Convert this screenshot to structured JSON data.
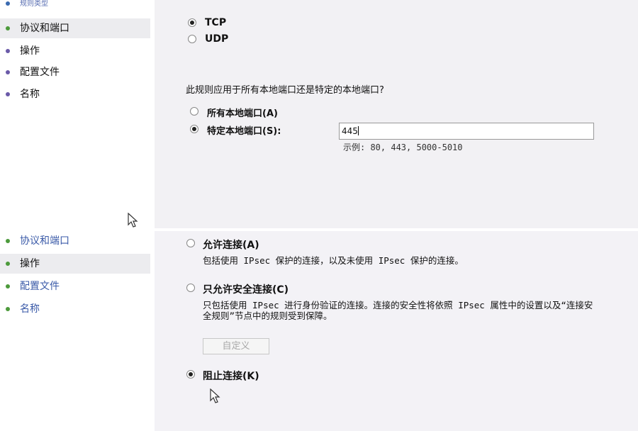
{
  "colors": {
    "content_bg": "#f2f1f4",
    "sidebar_bg": "#ffffff",
    "nav_selected_bg": "#ececef",
    "nav_dot_green": "#4c9a3b",
    "nav_dot_purple": "#6a5aa8"
  },
  "top_sidebar": {
    "cut_item": "规则类型",
    "items": [
      {
        "label": "协议和端口",
        "selected": true
      },
      {
        "label": "操作"
      },
      {
        "label": "配置文件"
      },
      {
        "label": "名称"
      }
    ]
  },
  "protocol": {
    "options": [
      {
        "label": "TCP",
        "checked": true
      },
      {
        "label": "UDP",
        "checked": false
      }
    ]
  },
  "ports": {
    "question": "此规则应用于所有本地端口还是特定的本地端口?",
    "all_ports_label": "所有本地端口(A)",
    "specific_ports_label": "特定本地端口(S):",
    "specific_checked": true,
    "value": "445",
    "example": "示例: 80, 443, 5000-5010"
  },
  "bottom_sidebar": {
    "items": [
      {
        "label": "协议和端口"
      },
      {
        "label": "操作",
        "selected": true
      },
      {
        "label": "配置文件"
      },
      {
        "label": "名称"
      }
    ]
  },
  "action": {
    "allow_label": "允许连接(A)",
    "allow_desc": "包括使用 IPsec 保护的连接，以及未使用 IPsec 保护的连接。",
    "allow_secure_label": "只允许安全连接(C)",
    "allow_secure_desc": "只包括使用 IPsec 进行身份验证的连接。连接的安全性将依照 IPsec 属性中的设置以及“连接安全规则”节点中的规则受到保障。",
    "customize_button": "自定义",
    "block_label": "阻止连接(K)",
    "selected": "block"
  },
  "icons": [
    "radio-button-icon",
    "mouse-cursor-icon",
    "nav-bullet-icon"
  ]
}
